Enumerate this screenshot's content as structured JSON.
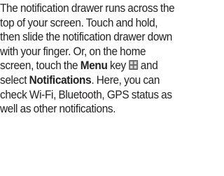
{
  "paragraph": {
    "part1": "The notification drawer runs across the top of your screen. Touch and hold, then slide the notification drawer down with your finger. Or, on the home screen, touch the ",
    "menu_bold": "Menu",
    "part2": " key ",
    "icon": "menu-key-icon",
    "part3": " and select ",
    "notifications_bold": "Notifications",
    "part4": ". Here, you can check Wi-Fi, Bluetooth, GPS status as well as other notifications."
  }
}
